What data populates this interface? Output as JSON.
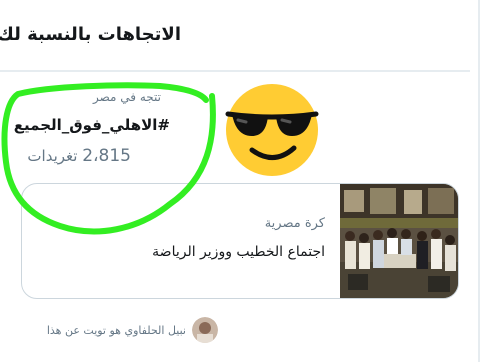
{
  "header": {
    "title": "الاتجاهات بالنسبة لك"
  },
  "trend": {
    "context": "تتجه في مصر",
    "name": "#الاهلي_فوق_الجميع",
    "count_number": "2،815",
    "count_label": "تغريدات"
  },
  "overlays": {
    "emoji_icon": "sunglasses-face-icon",
    "scribble_color": "#33ee22"
  },
  "news_card": {
    "category": "كرة مصرية",
    "headline": "اجتماع الخطيب ووزير الرياضة"
  },
  "footer": {
    "text": "نبيل الحلفاوي هو تويت عن هذا"
  },
  "colors": {
    "text_primary": "#14171a",
    "text_secondary": "#657786",
    "border": "#ccd6dd",
    "divider": "#e6ecf0",
    "emoji_yellow": "#ffcc33"
  }
}
